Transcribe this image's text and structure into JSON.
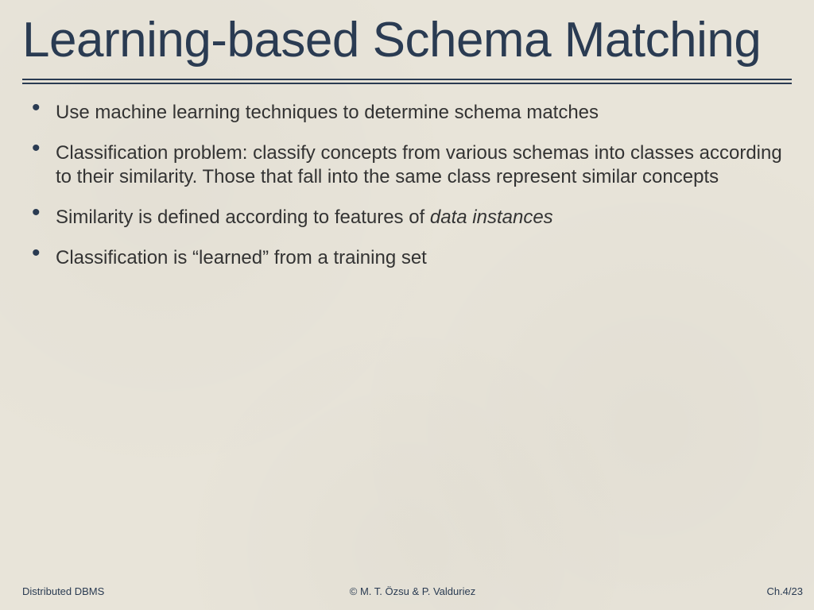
{
  "title": "Learning-based Schema Matching",
  "bullets": [
    {
      "text": "Use machine learning techniques to determine schema matches"
    },
    {
      "text": "Classification problem: classify concepts from various schemas into classes according to their similarity. Those that fall into the same class represent similar concepts"
    },
    {
      "prefix": "Similarity is defined according to features of ",
      "italic": "data instances"
    },
    {
      "text": "Classification is “learned” from a training set"
    }
  ],
  "footer": {
    "left": "Distributed DBMS",
    "center": "© M. T. Özsu & P. Valduriez",
    "right": "Ch.4/23"
  }
}
